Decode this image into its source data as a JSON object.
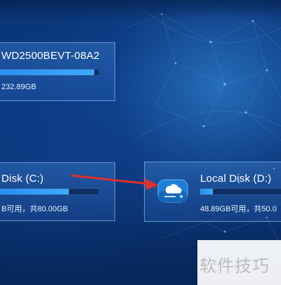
{
  "drives": [
    {
      "name": "WD2500BEVT-08A2",
      "capacity_text": "232.89GB",
      "used_fraction": 0.95
    },
    {
      "name": "Disk (C:)",
      "capacity_text": "B可用，共80.00GB",
      "used_fraction": 0.7
    },
    {
      "name": "Local Disk (D:)",
      "capacity_text": "48.89GB可用，共50.0",
      "used_fraction": 0.15,
      "icon": "cloud-drive-icon"
    }
  ],
  "watermark": {
    "text": "软件技巧"
  },
  "colors": {
    "accent": "#3fa9ff",
    "arrow": "#e0302a"
  }
}
